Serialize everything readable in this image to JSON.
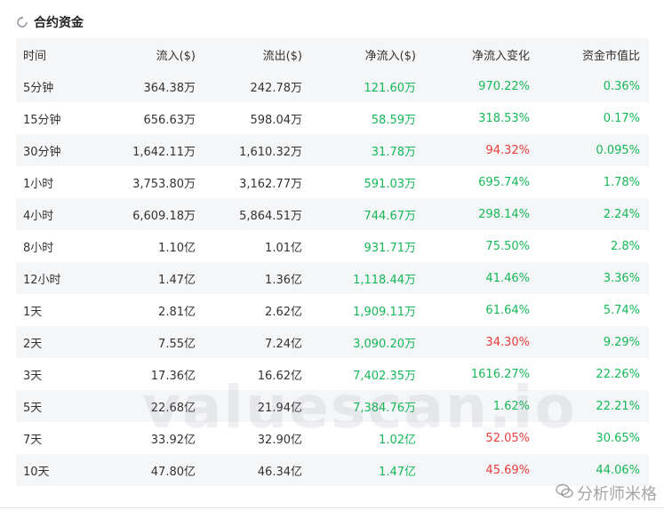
{
  "header": {
    "title": "合约资金",
    "icon": "refresh-icon"
  },
  "table": {
    "columns": [
      "时间",
      "流入($)",
      "流出($)",
      "净流入($)",
      "净流入变化",
      "资金市值比"
    ],
    "rows": [
      {
        "time": "5分钟",
        "inflow": "364.38万",
        "outflow": "242.78万",
        "net": "121.60万",
        "change": "970.22%",
        "change_dir": "pos",
        "ratio": "0.36%"
      },
      {
        "time": "15分钟",
        "inflow": "656.63万",
        "outflow": "598.04万",
        "net": "58.59万",
        "change": "318.53%",
        "change_dir": "pos",
        "ratio": "0.17%"
      },
      {
        "time": "30分钟",
        "inflow": "1,642.11万",
        "outflow": "1,610.32万",
        "net": "31.78万",
        "change": "94.32%",
        "change_dir": "neg",
        "ratio": "0.095%"
      },
      {
        "time": "1小时",
        "inflow": "3,753.80万",
        "outflow": "3,162.77万",
        "net": "591.03万",
        "change": "695.74%",
        "change_dir": "pos",
        "ratio": "1.78%"
      },
      {
        "time": "4小时",
        "inflow": "6,609.18万",
        "outflow": "5,864.51万",
        "net": "744.67万",
        "change": "298.14%",
        "change_dir": "pos",
        "ratio": "2.24%"
      },
      {
        "time": "8小时",
        "inflow": "1.10亿",
        "outflow": "1.01亿",
        "net": "931.71万",
        "change": "75.50%",
        "change_dir": "pos",
        "ratio": "2.8%"
      },
      {
        "time": "12小时",
        "inflow": "1.47亿",
        "outflow": "1.36亿",
        "net": "1,118.44万",
        "change": "41.46%",
        "change_dir": "pos",
        "ratio": "3.36%"
      },
      {
        "time": "1天",
        "inflow": "2.81亿",
        "outflow": "2.62亿",
        "net": "1,909.11万",
        "change": "61.64%",
        "change_dir": "pos",
        "ratio": "5.74%"
      },
      {
        "time": "2天",
        "inflow": "7.55亿",
        "outflow": "7.24亿",
        "net": "3,090.20万",
        "change": "34.30%",
        "change_dir": "neg",
        "ratio": "9.29%"
      },
      {
        "time": "3天",
        "inflow": "17.36亿",
        "outflow": "16.62亿",
        "net": "7,402.35万",
        "change": "1616.27%",
        "change_dir": "pos",
        "ratio": "22.26%"
      },
      {
        "time": "5天",
        "inflow": "22.68亿",
        "outflow": "21.94亿",
        "net": "7,384.76万",
        "change": "1.62%",
        "change_dir": "pos",
        "ratio": "22.21%"
      },
      {
        "time": "7天",
        "inflow": "33.92亿",
        "outflow": "32.90亿",
        "net": "1.02亿",
        "change": "52.05%",
        "change_dir": "neg",
        "ratio": "30.65%"
      },
      {
        "time": "10天",
        "inflow": "47.80亿",
        "outflow": "46.34亿",
        "net": "1.47亿",
        "change": "45.69%",
        "change_dir": "neg",
        "ratio": "44.06%"
      }
    ]
  },
  "watermark": {
    "text": "valuescan.io",
    "source": "分析师米格",
    "icon": "wechat-icon"
  },
  "colors": {
    "positive": "#15b857",
    "negative": "#e93c3c",
    "stripe": "#f5f6f8"
  }
}
